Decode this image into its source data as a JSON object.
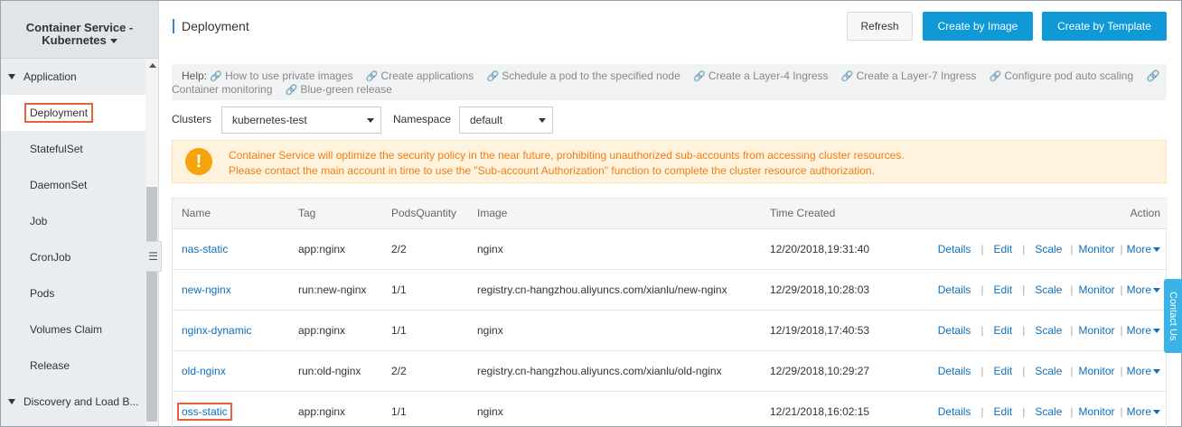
{
  "sidebar": {
    "title_line1": "Container Service -",
    "title_line2": "Kubernetes",
    "group_application": "Application",
    "items": [
      "Deployment",
      "StatefulSet",
      "DaemonSet",
      "Job",
      "CronJob",
      "Pods",
      "Volumes Claim",
      "Release"
    ],
    "group_discovery": "Discovery and Load B...",
    "active_item": "Deployment"
  },
  "header": {
    "title": "Deployment",
    "refresh_label": "Refresh",
    "create_image_label": "Create by Image",
    "create_template_label": "Create by Template"
  },
  "help": {
    "label": "Help:",
    "links": [
      "How to use private images",
      "Create applications",
      "Schedule a pod to the specified node",
      "Create a Layer-4 Ingress",
      "Create a Layer-7 Ingress",
      "Configure pod auto scaling",
      "Container monitoring",
      "Blue-green release"
    ]
  },
  "filters": {
    "clusters_label": "Clusters",
    "clusters_value": "kubernetes-test",
    "namespace_label": "Namespace",
    "namespace_value": "default"
  },
  "notice": {
    "line1": "Container Service will optimize the security policy in the near future, prohibiting unauthorized sub-accounts from accessing cluster resources.",
    "line2": "Please contact the main account in time to use the \"Sub-account Authorization\" function to complete the cluster resource authorization."
  },
  "table": {
    "columns": [
      "Name",
      "Tag",
      "PodsQuantity",
      "Image",
      "Time Created",
      "Action"
    ],
    "rows": [
      {
        "name": "nas-static",
        "tag": "app:nginx",
        "pods": "2/2",
        "image": "nginx",
        "time": "12/20/2018,19:31:40"
      },
      {
        "name": "new-nginx",
        "tag": "run:new-nginx",
        "pods": "1/1",
        "image": "registry.cn-hangzhou.aliyuncs.com/xianlu/new-nginx",
        "time": "12/29/2018,10:28:03"
      },
      {
        "name": "nginx-dynamic",
        "tag": "app:nginx",
        "pods": "1/1",
        "image": "nginx",
        "time": "12/19/2018,17:40:53"
      },
      {
        "name": "old-nginx",
        "tag": "run:old-nginx",
        "pods": "2/2",
        "image": "registry.cn-hangzhou.aliyuncs.com/xianlu/old-nginx",
        "time": "12/29/2018,10:29:27"
      },
      {
        "name": "oss-static",
        "tag": "app:nginx",
        "pods": "1/1",
        "image": "nginx",
        "time": "12/21/2018,16:02:15"
      }
    ],
    "actions": {
      "details": "Details",
      "edit": "Edit",
      "scale": "Scale",
      "monitor": "Monitor",
      "more": "More",
      "separator": "|"
    }
  },
  "contact": {
    "label": "Contact Us"
  },
  "colors": {
    "primary": "#0f99d6",
    "link": "#0f6fbd",
    "warning": "#f27d17",
    "highlight_outline": "#e6623a"
  }
}
